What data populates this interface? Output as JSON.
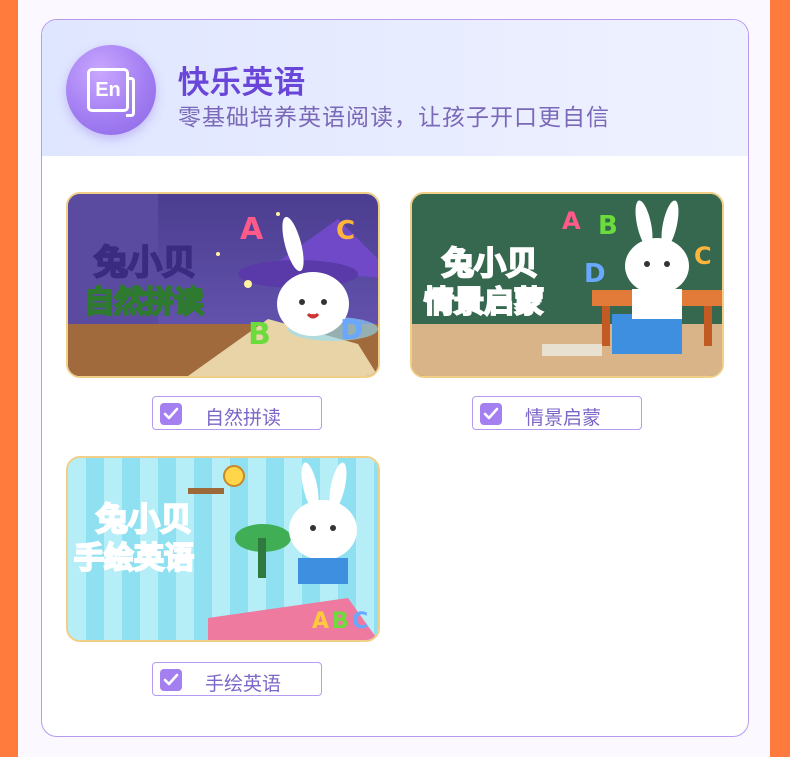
{
  "section": {
    "icon_text": "En",
    "title": "快乐英语",
    "subtitle": "零基础培养英语阅读，让孩子开口更自信"
  },
  "courses": [
    {
      "label": "自然拼读",
      "thumb_text_1": "兔小贝",
      "thumb_text_2": "自然拼读",
      "checked": true
    },
    {
      "label": "情景启蒙",
      "thumb_text_1": "兔小贝",
      "thumb_text_2": "情景启蒙",
      "checked": true
    },
    {
      "label": "手绘英语",
      "thumb_text_1": "兔小贝",
      "thumb_text_2": "手绘英语",
      "checked": true
    }
  ],
  "letters": [
    "A",
    "B",
    "C",
    "D"
  ],
  "colors": {
    "accent": "#8c66e6",
    "outer_border": "#ff7a3d",
    "chip_border": "#b49df0"
  }
}
